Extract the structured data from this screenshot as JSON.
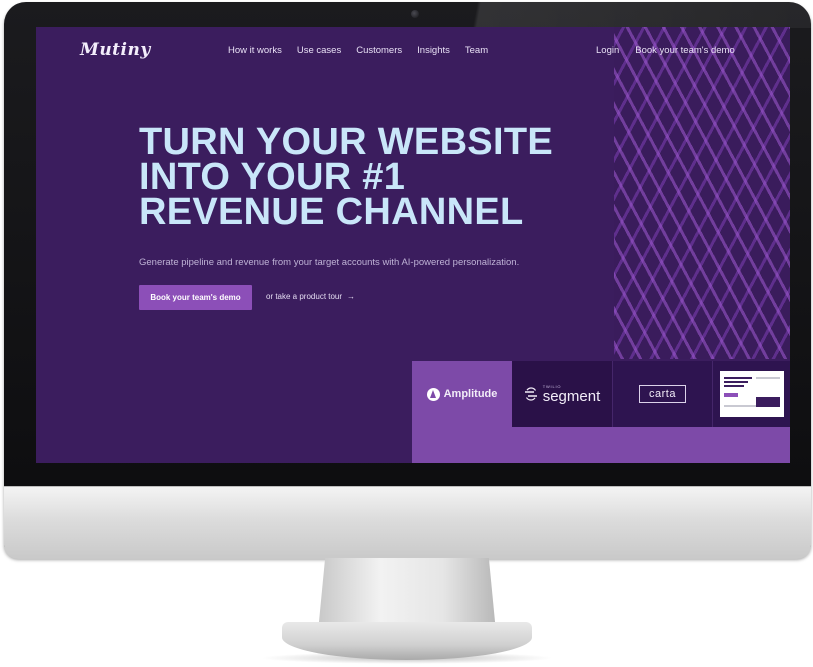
{
  "site": {
    "logo": "Mutiny",
    "nav": {
      "links": [
        "How it works",
        "Use cases",
        "Customers",
        "Insights",
        "Team"
      ],
      "login": "Login",
      "cta": "Book your team's demo"
    },
    "hero": {
      "title_lines": [
        "TURN YOUR WEBSITE",
        "INTO YOUR #1",
        "REVENUE CHANNEL"
      ],
      "subtitle": "Generate pipeline and revenue from your target accounts with AI-powered personalization.",
      "primary_button": "Book your team's demo",
      "secondary_link": "or take a product tour",
      "secondary_arrow": "→"
    },
    "customer_logos": {
      "amplitude": "Amplitude",
      "segment_small": "TWILIO",
      "segment": "segment",
      "carta": "carta"
    }
  },
  "colors": {
    "background": "#3b1d5e",
    "title": "#c9e6f9",
    "accent": "#8c4fb8",
    "strip": "#7d4aa8"
  },
  "icons": [
    "camera-dot",
    "amplitude-logo-icon",
    "segment-logo-icon",
    "arrow-right-icon"
  ]
}
